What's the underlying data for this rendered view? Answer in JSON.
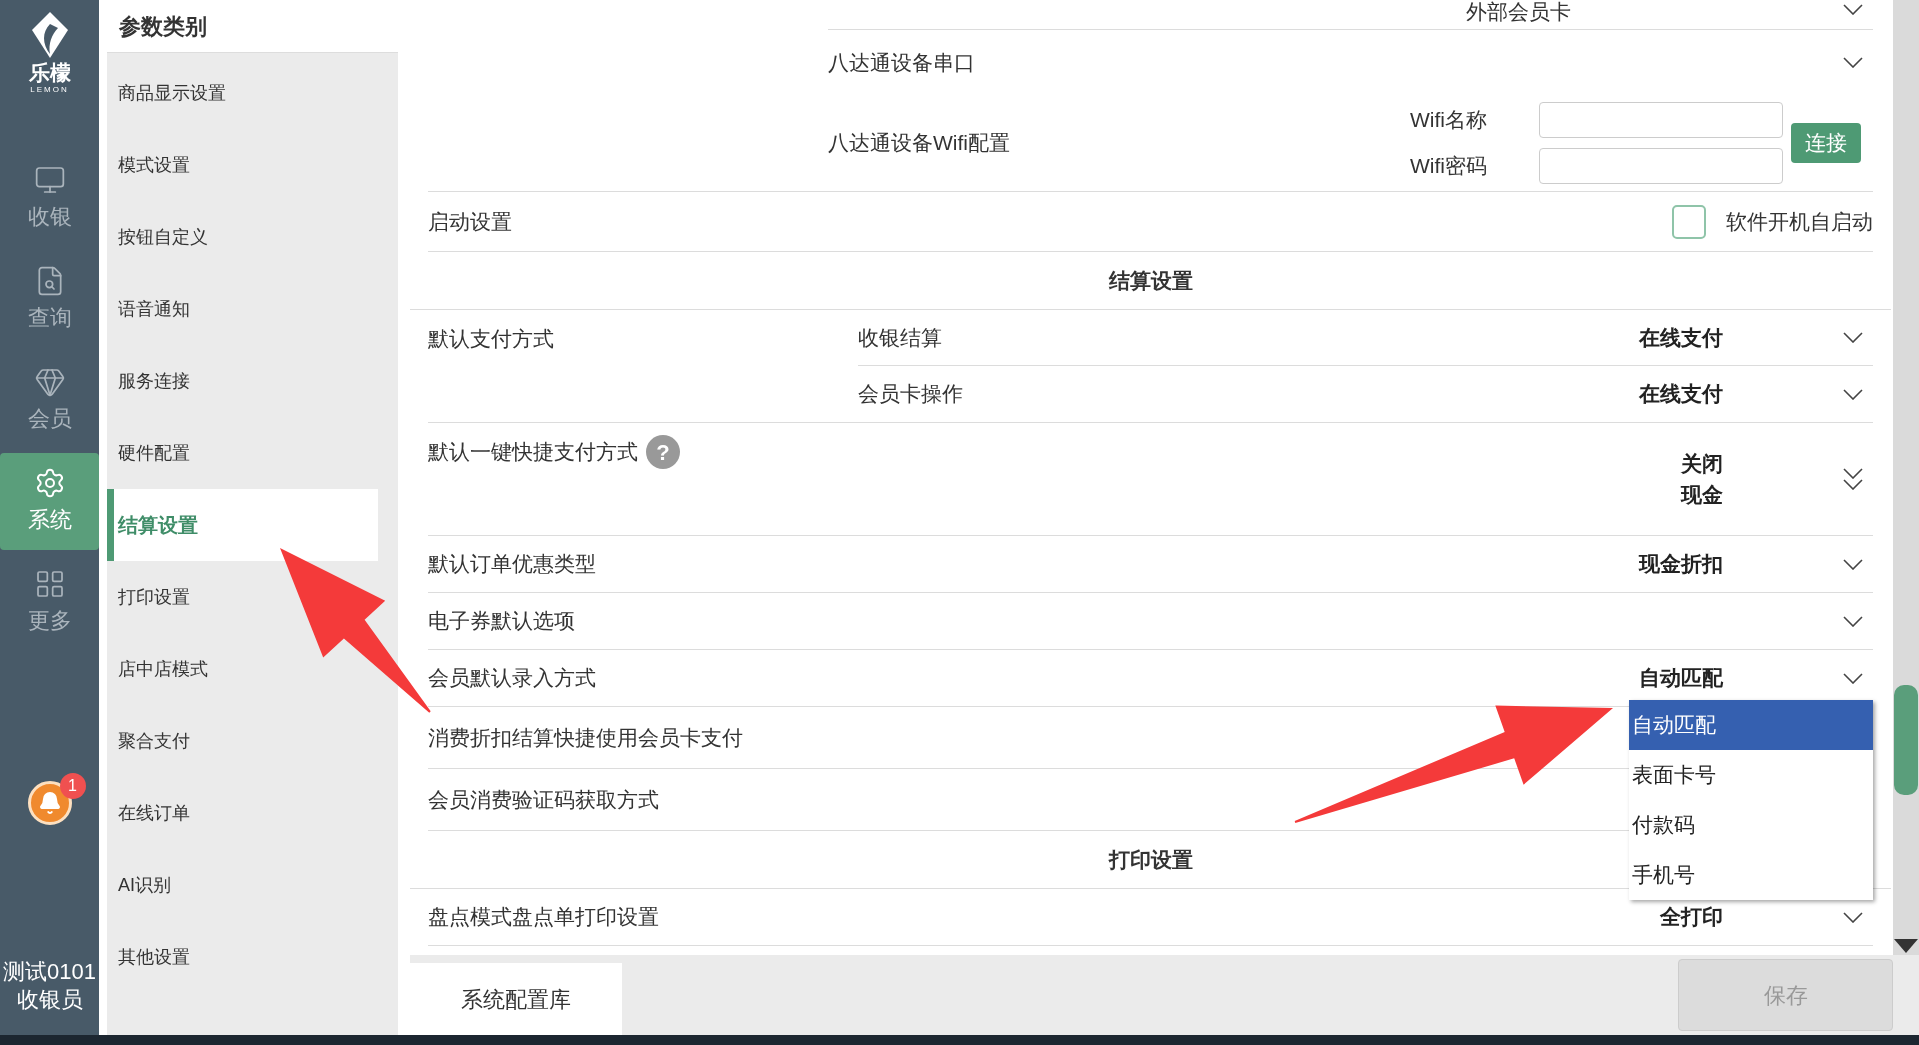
{
  "nav": {
    "logo_text": "乐檬",
    "logo_subtext": "LEMON",
    "items": [
      {
        "kind": "register",
        "label": "收银",
        "selected": false
      },
      {
        "kind": "query",
        "label": "查询",
        "selected": false
      },
      {
        "kind": "member",
        "label": "会员",
        "selected": false
      },
      {
        "kind": "system",
        "label": "系统",
        "selected": true
      },
      {
        "kind": "more",
        "label": "更多",
        "selected": false
      }
    ],
    "notification_count": "1",
    "user": {
      "name": "测试0101",
      "role": "收银员"
    }
  },
  "categories": {
    "title": "参数类别",
    "items": [
      {
        "label": "商品显示设置",
        "selected": false
      },
      {
        "label": "模式设置",
        "selected": false
      },
      {
        "label": "按钮自定义",
        "selected": false
      },
      {
        "label": "语音通知",
        "selected": false
      },
      {
        "label": "服务连接",
        "selected": false
      },
      {
        "label": "硬件配置",
        "selected": false
      },
      {
        "label": "结算设置",
        "selected": true
      },
      {
        "label": "打印设置",
        "selected": false
      },
      {
        "label": "店中店模式",
        "selected": false
      },
      {
        "label": "聚合支付",
        "selected": false
      },
      {
        "label": "在线订单",
        "selected": false
      },
      {
        "label": "AI识别",
        "selected": false
      },
      {
        "label": "其他设置",
        "selected": false
      }
    ]
  },
  "settings": [
    {
      "kind": "cut-select",
      "value": "外部会员卡"
    },
    {
      "kind": "sub-select",
      "sub_label": "八达通设备串口"
    },
    {
      "kind": "wifi",
      "sub_label": "八达通设备Wifi配置",
      "fields": [
        {
          "label": "Wifi名称"
        },
        {
          "label": "Wifi密码"
        }
      ],
      "button": "连接"
    },
    {
      "kind": "checkbox",
      "label": "启动设置",
      "option": "软件开机自启动",
      "checked": false
    },
    {
      "kind": "heading",
      "label": "结算设置"
    },
    {
      "kind": "multi",
      "label": "默认支付方式",
      "selects": [
        {
          "sub_label": "收银结算",
          "value": "在线支付"
        },
        {
          "sub_label": "会员卡操作",
          "value": "在线支付"
        }
      ]
    },
    {
      "kind": "multi",
      "label": "默认一键快捷支付方式",
      "help_icon": "?",
      "selects": [
        {
          "value": "关闭"
        },
        {
          "value": "现金"
        }
      ]
    },
    {
      "kind": "select",
      "label": "默认订单优惠类型",
      "value": "现金折扣"
    },
    {
      "kind": "select",
      "label": "电子券默认选项"
    },
    {
      "kind": "select",
      "label": "会员默认录入方式",
      "value": "自动匹配",
      "expanded": true,
      "options": [
        {
          "label": "自动匹配",
          "selected": true
        },
        {
          "label": "表面卡号",
          "selected": false
        },
        {
          "label": "付款码",
          "selected": false
        },
        {
          "label": "手机号",
          "selected": false
        }
      ]
    },
    {
      "kind": "plain",
      "label": "消费折扣结算快捷使用会员卡支付"
    },
    {
      "kind": "plain",
      "label": "会员消费验证码获取方式"
    },
    {
      "kind": "heading",
      "label": "打印设置"
    },
    {
      "kind": "select",
      "label": "盘点模式盘点单打印设置",
      "value": "全打印"
    }
  ],
  "footer": {
    "library_button": "系统配置库",
    "save_button": {
      "label": "保存",
      "disabled": true
    }
  }
}
